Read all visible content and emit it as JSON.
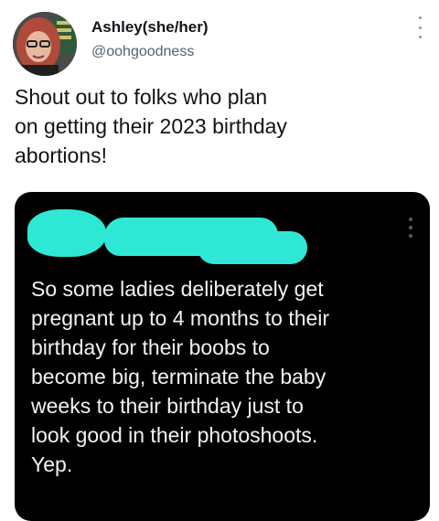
{
  "tweet": {
    "author_name": "Ashley(she/her)",
    "author_handle": "@oohgoodness",
    "text": "Shout out to folks who plan\non getting their 2023 birthday\nabortions!"
  },
  "quoted_screenshot": {
    "text": "So some ladies deliberately get\npregnant up to 4 months to their\nbirthday for their boobs to\nbecome big, terminate the baby\nweeks to their birthday just to\nlook good in their photoshoots.\nYep."
  },
  "icons": {
    "tweet_menu": "more-vertical-icon",
    "screenshot_menu": "more-vertical-icon"
  },
  "colors": {
    "redaction": "#2ee8d5",
    "handle": "#536471",
    "media_background": "#000000"
  }
}
